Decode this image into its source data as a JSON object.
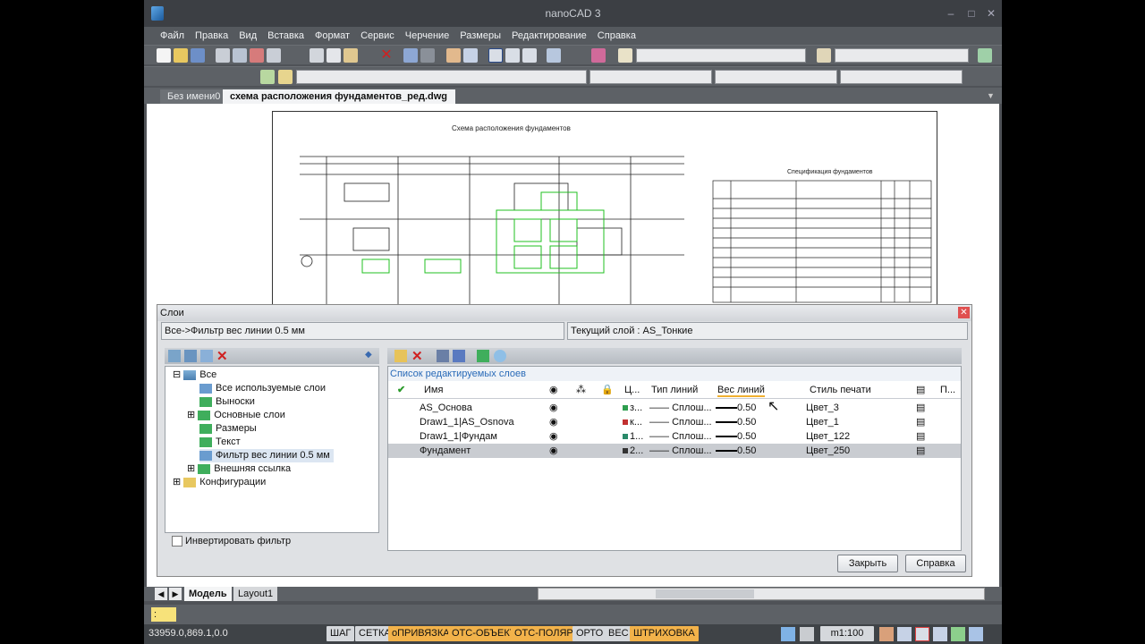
{
  "window": {
    "title": "nanoCAD 3"
  },
  "menu": [
    "Файл",
    "Правка",
    "Вид",
    "Вставка",
    "Формат",
    "Сервис",
    "Черчение",
    "Размеры",
    "Редактирование",
    "Справка"
  ],
  "doc_tabs": {
    "tab1": "Без имени0",
    "tab2": "схема расположения фундаментов_ред.dwg",
    "close": "✕"
  },
  "drawing": {
    "title": "Схема расположения фундаментов",
    "spec_title": "Спецификация фундаментов"
  },
  "layers_dialog": {
    "title": "Слои",
    "filter_path": "Все->Фильтр вес линии 0.5 мм",
    "current_layer": "Текущий слой : AS_Тонкие",
    "list_caption": "Список редактируемых слоев",
    "tree": [
      "Все",
      "Все используемые слои",
      "Выноски",
      "Основные слои",
      "Размеры",
      "Текст",
      "Фильтр вес линии 0.5 мм",
      "Внешняя ссылка",
      "Конфигурации"
    ],
    "invert_filter": "Инвертировать фильтр",
    "columns": {
      "name": "Имя",
      "color": "Ц...",
      "linetype": "Тип линий",
      "lineweight": "Вес линий",
      "plotstyle": "Стиль печати",
      "plot": "П..."
    },
    "rows": [
      {
        "name": "AS_Основа",
        "color": "з...",
        "color_hex": "#2e9e4f",
        "linetype": "Сплош...",
        "lineweight": "0.50",
        "plotstyle": "Цвет_3"
      },
      {
        "name": "Draw1_1|AS_Osnova",
        "color": "к...",
        "color_hex": "#c23030",
        "linetype": "Сплош...",
        "lineweight": "0.50",
        "plotstyle": "Цвет_1"
      },
      {
        "name": "Draw1_1|Фундам",
        "color": "1...",
        "color_hex": "#2a8a6a",
        "linetype": "Сплош...",
        "lineweight": "0.50",
        "plotstyle": "Цвет_122"
      },
      {
        "name": "Фундамент",
        "color": "2...",
        "color_hex": "#333333",
        "linetype": "Сплош...",
        "lineweight": "0.50",
        "plotstyle": "Цвет_250"
      }
    ],
    "btn_close": "Закрыть",
    "btn_help": "Справка"
  },
  "layout_tabs": {
    "model": "Модель",
    "layout1": "Layout1"
  },
  "cmd": {
    "prompt": ":"
  },
  "status": {
    "coords": "33959.0,869.1,0.0",
    "toggles": [
      "ШАГ",
      "СЕТКА",
      "оПРИВЯЗКА",
      "ОТС-ОБЪЕКТ",
      "ОТС-ПОЛЯР",
      "ОРТО",
      "ВЕС",
      "ШТРИХОВКА"
    ],
    "scale": "m1:100"
  }
}
